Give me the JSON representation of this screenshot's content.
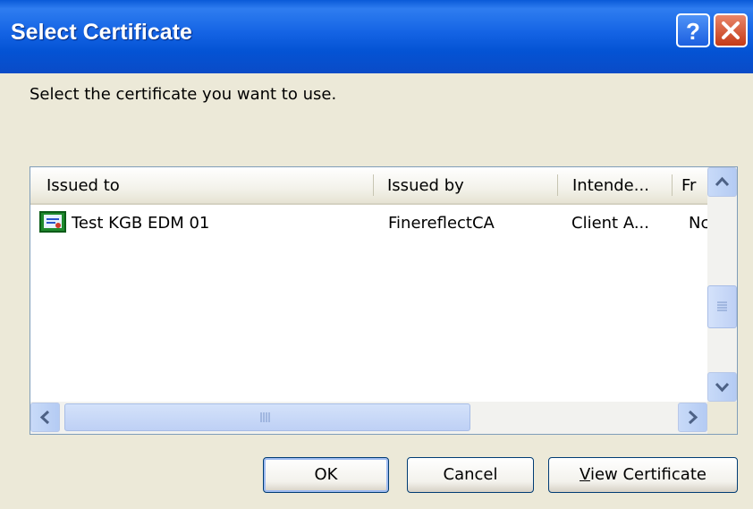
{
  "window": {
    "title": "Select Certificate"
  },
  "prompt": "Select the certificate you want to use.",
  "columns": [
    "Issued to",
    "Issued by",
    "Intende...",
    "Fr"
  ],
  "rows": [
    {
      "issued_to": "Test KGB EDM 01",
      "issued_by": "FinereflectCA",
      "intended": "Client A...",
      "friendly": "Nc"
    }
  ],
  "buttons": {
    "ok": "OK",
    "cancel": "Cancel",
    "view_mnemonic": "V",
    "view_rest": "iew Certificate"
  },
  "icons": [
    "help-icon",
    "close-icon",
    "certificate-icon",
    "scroll-up-icon",
    "scroll-down-icon",
    "scroll-left-icon",
    "scroll-right-icon",
    "grip-icon"
  ],
  "colors": {
    "titlebar": "#0453d4",
    "close": "#c43a17",
    "face": "#ece9d8"
  }
}
